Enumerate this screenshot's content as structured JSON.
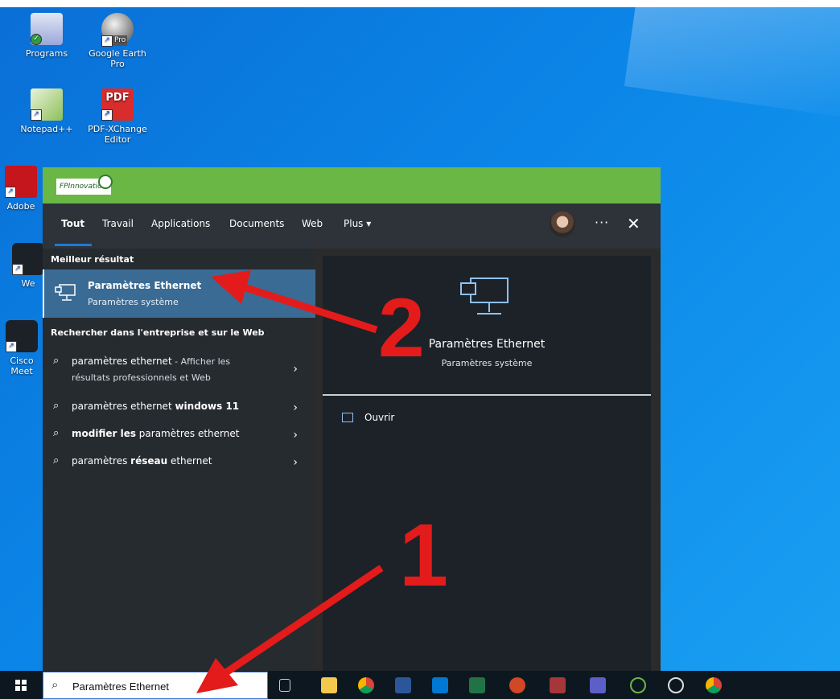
{
  "desktop": {
    "icons": [
      {
        "label": "Programs",
        "icon": "programs-icon"
      },
      {
        "label": "Google Earth Pro",
        "icon": "google-earth-icon",
        "badge": "Pro"
      },
      {
        "label": "Notepad++",
        "icon": "notepadpp-icon"
      },
      {
        "label": "PDF-XChange Editor",
        "icon": "pdf-xchange-icon",
        "badge": "PDF"
      },
      {
        "label": "Adobe",
        "icon": "adobe-icon"
      },
      {
        "label": "We",
        "icon": "webex-icon"
      },
      {
        "label": "Cisco Meet",
        "icon": "cisco-webex-icon"
      }
    ]
  },
  "search_panel": {
    "brand": "FPInnovations",
    "tabs": [
      "Tout",
      "Travail",
      "Applications",
      "Documents",
      "Web",
      "Plus ▾"
    ],
    "active_tab": "Tout",
    "best_match_label": "Meilleur résultat",
    "best_match": {
      "title": "Paramètres Ethernet",
      "subtitle": "Paramètres système"
    },
    "web_section_label": "Rechercher dans l'entreprise et sur le Web",
    "suggestions": [
      {
        "plain": "paramètres ethernet",
        "bold": "",
        "extra": " - Afficher les",
        "line2": "résultats professionnels et Web"
      },
      {
        "plain": "paramètres ethernet ",
        "bold": "windows 11",
        "extra": "",
        "line2": ""
      },
      {
        "plain": "",
        "bold": "modifier les",
        "after": " paramètres ethernet"
      },
      {
        "plain": "paramètres ",
        "bold": "réseau",
        "after": " ethernet"
      }
    ],
    "preview": {
      "title": "Paramètres Ethernet",
      "subtitle": "Paramètres système",
      "open_action": "Ouvrir"
    }
  },
  "taskbar": {
    "search_value": "Paramètres Ethernet",
    "apps": [
      "task-view-icon",
      "file-explorer-icon",
      "chrome-icon",
      "word-icon",
      "outlook-icon",
      "excel-icon",
      "powerpoint-icon",
      "access-icon",
      "teams-icon",
      "app-leaf-icon",
      "media-player-icon",
      "chrome-alt-icon"
    ]
  },
  "annotations": {
    "step1": "1",
    "step2": "2"
  },
  "colors": {
    "accent": "#1c7ad8",
    "brand_bar": "#6ab745",
    "annotation": "#e31b1b"
  }
}
